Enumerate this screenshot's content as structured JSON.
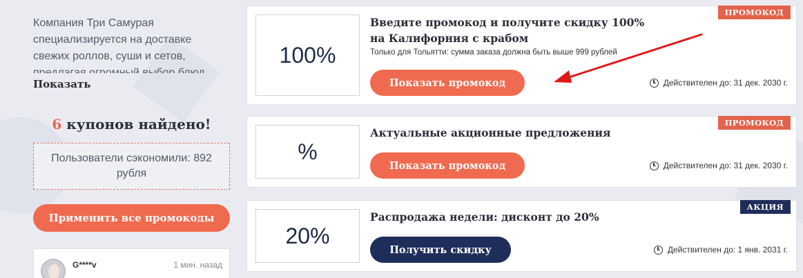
{
  "store": {
    "intro": "Компания Три Самурая специализируется на доставке свежих роллов, суши и сетов, предлагая огромный выбор блюд",
    "show_more": "Показать",
    "found_count": "6",
    "found_text": " купонов найдено!",
    "saved_text": "Пользователи сэкономили: 892 рубля",
    "apply_all": "Применить все промокоды"
  },
  "review": {
    "user": "G****v",
    "time": "1 мин. назад"
  },
  "coupons": [
    {
      "value": "100%",
      "title": "Введите промокод и получите скидку 100% на Калифорния с крабом",
      "note": "Только для Тольятти: сумма заказа должна быть выше 999 рублей",
      "button": "Показать промокод",
      "badge": "ПРОМОКОД",
      "expiry": "Действителен до: 31 дек. 2030 г."
    },
    {
      "value": "%",
      "title": "Актуальные акционные предложения",
      "button": "Показать промокод",
      "badge": "ПРОМОКОД",
      "expiry": "Действителен до: 31 дек. 2030 г."
    },
    {
      "value": "20%",
      "title": "Распродажа недели: дисконт до 20%",
      "button": "Получить скидку",
      "badge": "АКЦИЯ",
      "expiry": "Действителен до: 1 янв. 2031 г."
    }
  ],
  "colors": {
    "accent_orange": "#ef6a4f",
    "navy": "#1f2d5a",
    "arrow_red": "#e01818"
  }
}
